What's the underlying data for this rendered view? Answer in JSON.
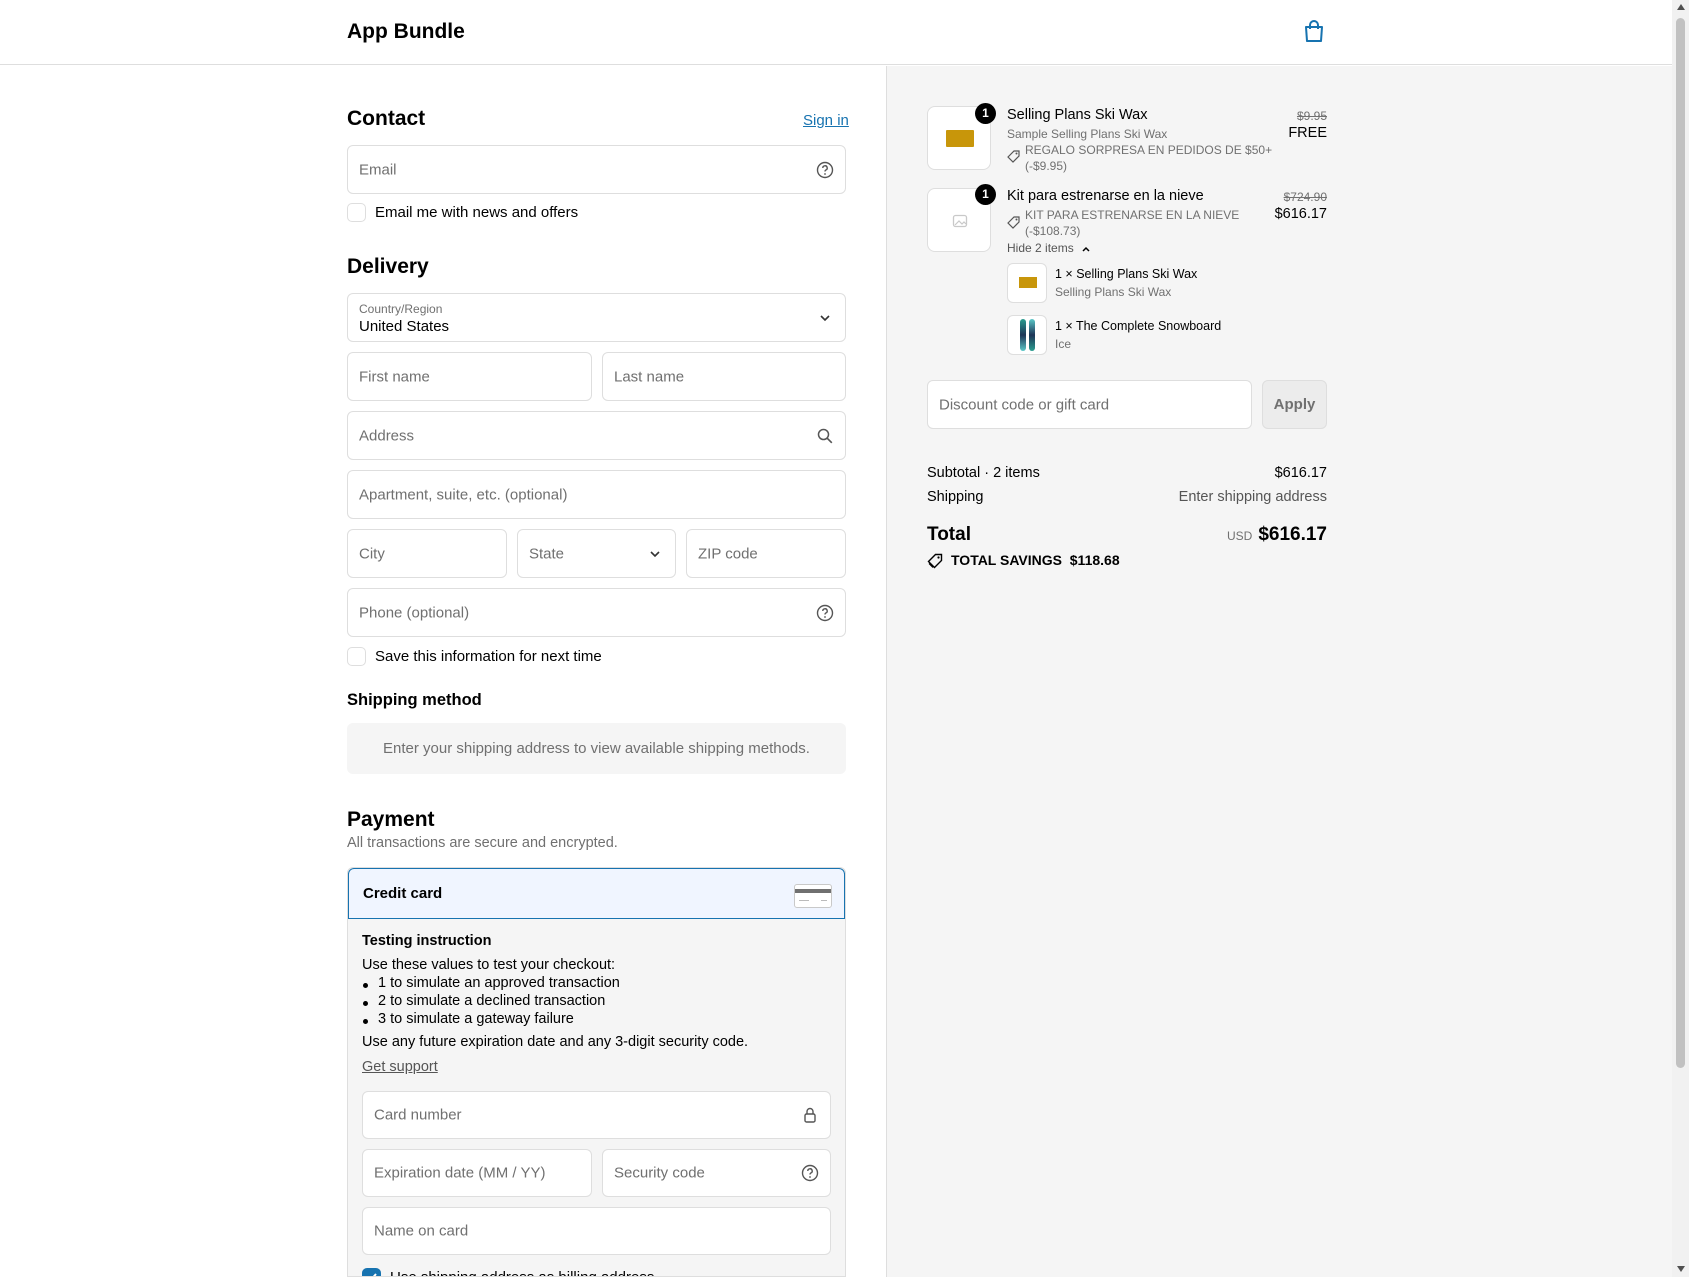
{
  "header": {
    "brand": "App Bundle",
    "cart_icon": "shopping-bag-icon"
  },
  "contact": {
    "title": "Contact",
    "sign_in": "Sign in",
    "email_placeholder": "Email",
    "news_label": "Email me with news and offers"
  },
  "delivery": {
    "title": "Delivery",
    "country_label": "Country/Region",
    "country_value": "United States",
    "first_name": "First name",
    "last_name": "Last name",
    "address": "Address",
    "apartment": "Apartment, suite, etc. (optional)",
    "city": "City",
    "state": "State",
    "zip": "ZIP code",
    "phone": "Phone (optional)",
    "save_label": "Save this information for next time"
  },
  "shipping_method": {
    "title": "Shipping method",
    "message": "Enter your shipping address to view available shipping methods."
  },
  "payment": {
    "title": "Payment",
    "subtitle": "All transactions are secure and encrypted.",
    "method": "Credit card",
    "instr_title": "Testing instruction",
    "instr_intro": "Use these values to test your checkout:",
    "bullets": [
      {
        "num": "1",
        "text": " to simulate an approved transaction"
      },
      {
        "num": "2",
        "text": " to simulate a declined transaction"
      },
      {
        "num": "3",
        "text": " to simulate a gateway failure"
      }
    ],
    "instr_footer": "Use any future expiration date and any 3-digit security code.",
    "support": "Get support",
    "card_number": "Card number",
    "expiration": "Expiration date (MM / YY)",
    "security": "Security code",
    "name_on_card": "Name on card",
    "billing_label": "Use shipping address as billing address"
  },
  "summary": {
    "items": [
      {
        "qty": "1",
        "name": "Selling Plans Ski Wax",
        "variant": "Sample Selling Plans Ski Wax",
        "discount": "REGALO SORPRESA EN PEDIDOS DE $50+",
        "discount_amount": "(-$9.95)",
        "original_price": "$9.95",
        "price": "FREE"
      },
      {
        "qty": "1",
        "name": "Kit para estrenarse en la nieve",
        "discount": "KIT PARA ESTRENARSE EN LA NIEVE",
        "discount_amount": "(-$108.73)",
        "original_price": "$724.90",
        "price": "$616.17",
        "toggle": "Hide 2 items",
        "components": [
          {
            "name": "1 × Selling Plans Ski Wax",
            "variant": "Selling Plans Ski Wax"
          },
          {
            "name": "1 × The Complete Snowboard",
            "variant": "Ice"
          }
        ]
      }
    ],
    "discount_placeholder": "Discount code or gift card",
    "apply": "Apply",
    "subtotal_label": "Subtotal · 2 items",
    "subtotal_value": "$616.17",
    "shipping_label": "Shipping",
    "shipping_value": "Enter shipping address",
    "total_label": "Total",
    "currency": "USD",
    "total_value": "$616.17",
    "savings_label": "TOTAL SAVINGS",
    "savings_value": "$118.68"
  },
  "colors": {
    "accent": "#1773b0",
    "border": "#dedede",
    "muted": "#707070",
    "panel": "#f5f5f5"
  }
}
